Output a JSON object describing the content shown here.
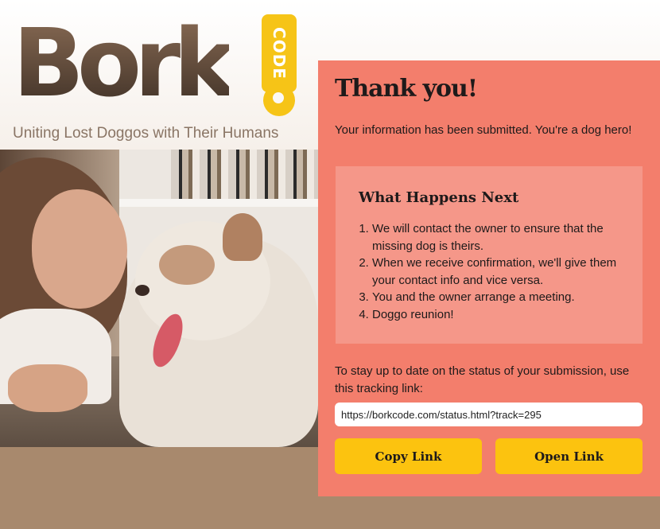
{
  "brand": {
    "logo_text": "Bork",
    "tag_text": "CODE",
    "tagline": "Uniting Lost Doggos with Their Humans"
  },
  "panel": {
    "title": "Thank you!",
    "message": "Your information has been submitted. You're a dog hero!",
    "next": {
      "title": "What Happens Next",
      "steps": [
        "We will contact the owner to ensure that the missing dog is theirs.",
        "When we receive confirmation, we'll give them your contact info and vice versa.",
        "You and the owner arrange a meeting.",
        "Doggo reunion!"
      ]
    },
    "tracking_text": "To stay up to date on the status of your submission, use this tracking link:",
    "tracking_url": "https://borkcode.com/status.html?track=295",
    "copy_label": "Copy Link",
    "open_label": "Open Link"
  },
  "colors": {
    "panel_bg": "#f37e6c",
    "button_bg": "#fcc30f",
    "logo_brown": "#4a3a2e",
    "tag_yellow": "#f6c417"
  }
}
